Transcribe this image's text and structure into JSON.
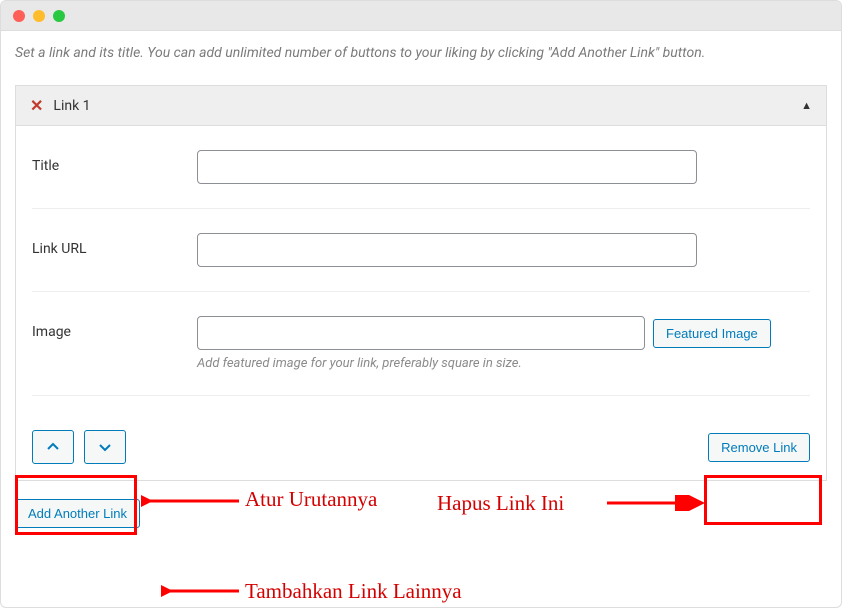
{
  "description": "Set a link and its title. You can add unlimited number of buttons to your liking by clicking \"Add Another Link\" button.",
  "panel": {
    "title": "Link 1",
    "fields": {
      "title_label": "Title",
      "url_label": "Link URL",
      "image_label": "Image",
      "image_hint": "Add featured image for your link, preferably square in size.",
      "featured_btn": "Featured Image"
    },
    "remove_btn": "Remove Link"
  },
  "add_btn": "Add Another Link",
  "annotations": {
    "order": "Atur Urutannya",
    "remove": "Hapus Link Ini",
    "add": "Tambahkan Link Lainnya"
  }
}
